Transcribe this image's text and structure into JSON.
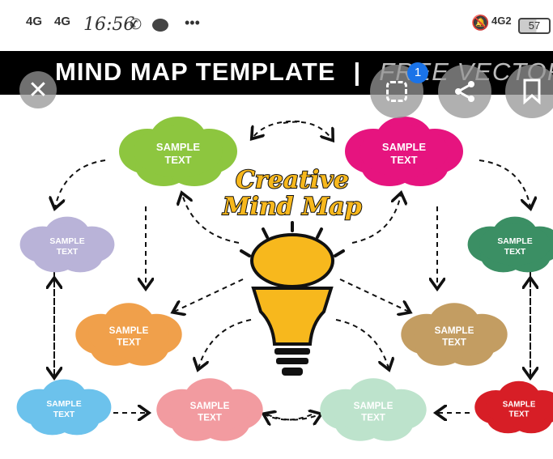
{
  "status_bar": {
    "signal1": "4G",
    "signal2": "4G",
    "time": "16:56",
    "network": "4G2",
    "battery": "57",
    "icons": [
      "whatsapp-icon",
      "message-icon",
      "more-icon",
      "bell-off-icon"
    ]
  },
  "image": {
    "banner_title": "MIND MAP TEMPLATE",
    "banner_sep": "|",
    "banner_sub": "FREE VECTOR",
    "center_title_1": "Creative",
    "center_title_2": "Mind Map",
    "clouds": [
      {
        "label1": "SAMPLE",
        "label2": "TEXT",
        "color": "#8dc63f"
      },
      {
        "label1": "SAMPLE",
        "label2": "TEXT",
        "color": "#e6147f"
      },
      {
        "label1": "SAMPLE",
        "label2": "TEXT",
        "color": "#b9b3d8"
      },
      {
        "label1": "SAMPLE",
        "label2": "TEXT",
        "color": "#3b8f64"
      },
      {
        "label1": "SAMPLE",
        "label2": "TEXT",
        "color": "#f0a04b"
      },
      {
        "label1": "SAMPLE",
        "label2": "TEXT",
        "color": "#c39d62"
      },
      {
        "label1": "SAMPLE",
        "label2": "TEXT",
        "color": "#6cc2ec"
      },
      {
        "label1": "SAMPLE",
        "label2": "TEXT",
        "color": "#f29ba0"
      },
      {
        "label1": "SAMPLE",
        "label2": "TEXT",
        "color": "#bde3cc"
      },
      {
        "label1": "SAMPLE",
        "label2": "TEXT",
        "color": "#d71e26"
      }
    ]
  },
  "viewer": {
    "badge": "1",
    "buttons": [
      "close",
      "lens",
      "share",
      "bookmark"
    ]
  }
}
